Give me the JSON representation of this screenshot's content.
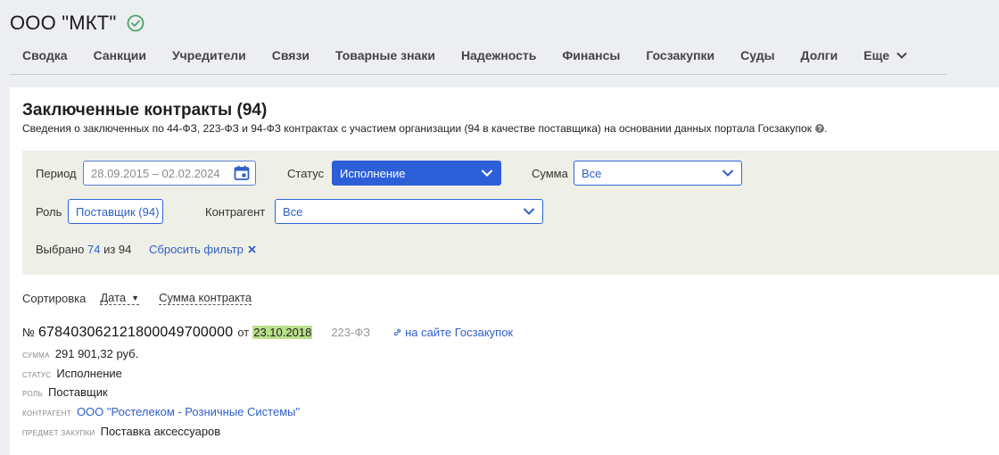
{
  "company": {
    "name": "ООО \"МКТ\"",
    "verified_icon": "check-circle-icon",
    "verified_color": "#4aa564"
  },
  "tabs": [
    {
      "label": "Сводка"
    },
    {
      "label": "Санкции"
    },
    {
      "label": "Учредители"
    },
    {
      "label": "Связи"
    },
    {
      "label": "Товарные знаки"
    },
    {
      "label": "Надежность"
    },
    {
      "label": "Финансы"
    },
    {
      "label": "Госзакупки"
    },
    {
      "label": "Суды"
    },
    {
      "label": "Долги"
    },
    {
      "label": "Еще"
    }
  ],
  "section": {
    "title": "Заключенные контракты (94)",
    "subtitle": "Сведения о заключенных по 44-ФЗ, 223-ФЗ и 94-ФЗ контрактах с участием организации (94 в качестве поставщика) на основании данных портала Госзакупок",
    "help_icon": "question-circle-icon"
  },
  "filters": {
    "period_label": "Период",
    "period_value": "28.09.2015 – 02.02.2024",
    "status_label": "Статус",
    "status_value": "Исполнение",
    "sum_label": "Сумма",
    "sum_value": "Все",
    "role_label": "Роль",
    "role_value": "Поставщик (94)",
    "counterparty_label": "Контрагент",
    "counterparty_value": "Все",
    "selected_prefix": "Выбрано",
    "selected_count": "74",
    "selected_suffix": "из 94",
    "reset_label": "Сбросить фильтр",
    "accent_color": "#2d5fd9",
    "background_color": "#eeefe6"
  },
  "sort": {
    "label": "Сортировка",
    "options": [
      {
        "label": "Дата"
      },
      {
        "label": "Сумма контракта"
      }
    ]
  },
  "contract": {
    "number_prefix": "№",
    "number": "678403062121800049700000",
    "from_label": "от",
    "date": "23.10.2018",
    "law": "223-ФЗ",
    "external_link": "на сайте Госзакупок",
    "fields": {
      "sum_key": "сумма",
      "sum_value": "291 901,32 руб.",
      "status_key": "статус",
      "status_value": "Исполнение",
      "role_key": "роль",
      "role_value": "Поставщик",
      "counterparty_key": "контрагент",
      "counterparty_value": "ООО \"Ростелеком - Розничные Системы\"",
      "subject_key": "предмет закупки",
      "subject_value": "Поставка аксессуаров"
    }
  }
}
